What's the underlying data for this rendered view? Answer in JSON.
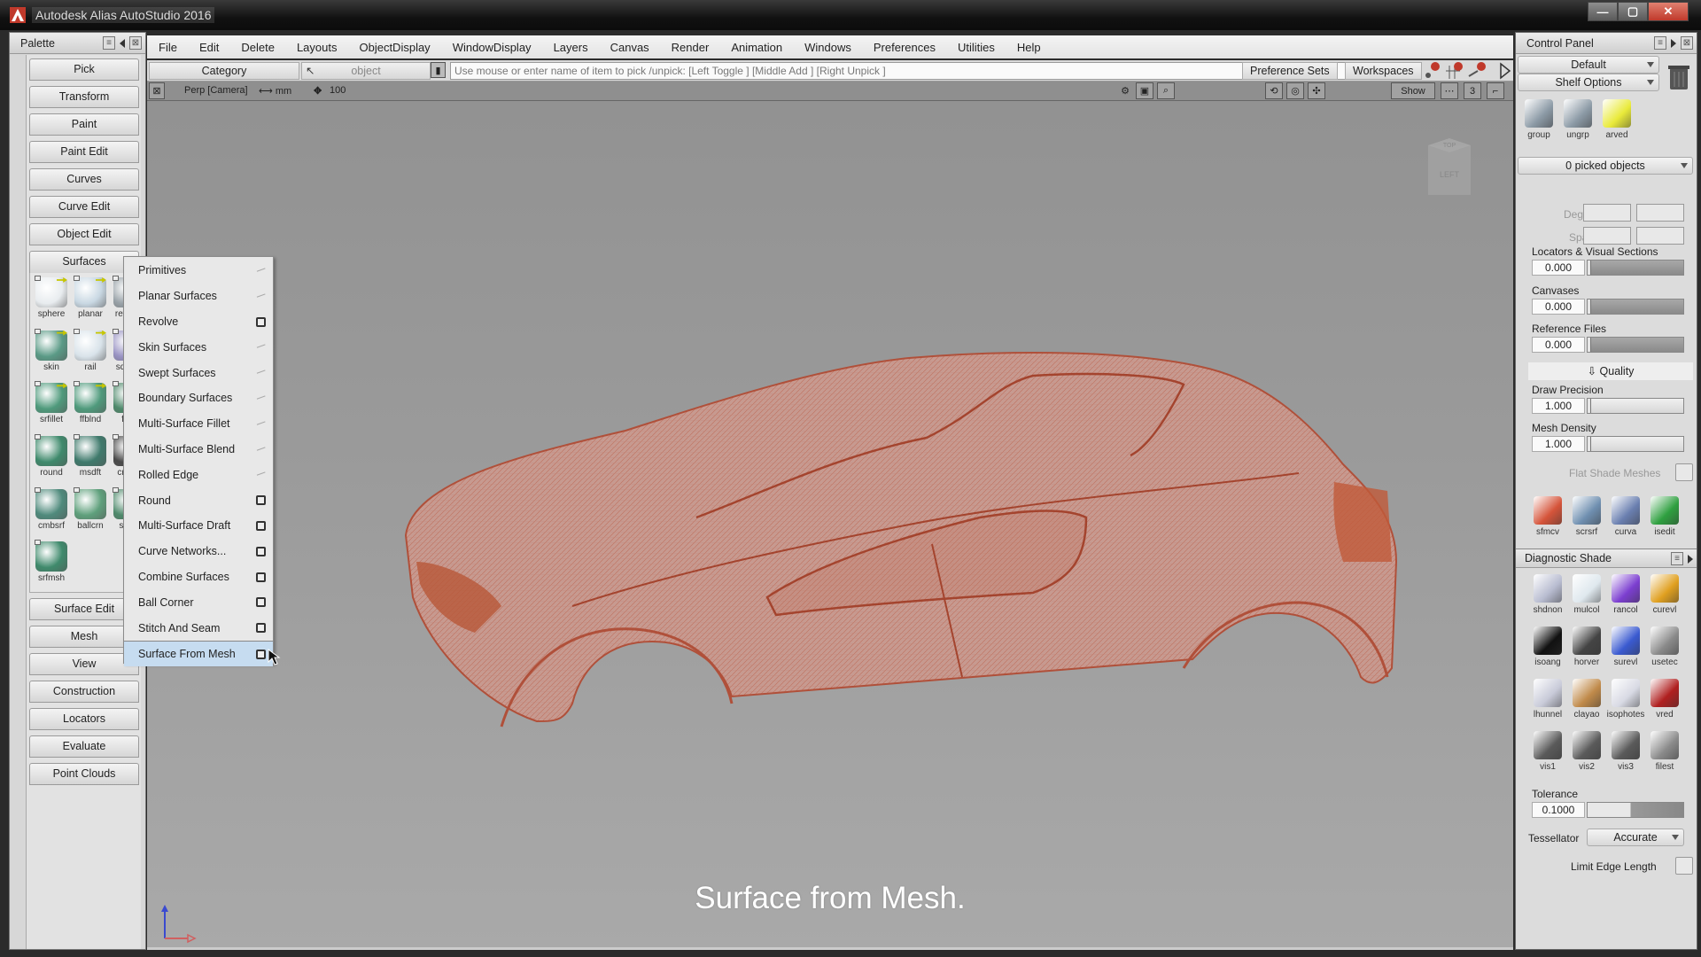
{
  "window": {
    "title": "Autodesk Alias AutoStudio 2016",
    "controls": {
      "minimize": "—",
      "maximize": "▢",
      "close": "✕"
    }
  },
  "menubar": {
    "items": [
      "File",
      "Edit",
      "Delete",
      "Layouts",
      "ObjectDisplay",
      "WindowDisplay",
      "Layers",
      "Canvas",
      "Render",
      "Animation",
      "Windows",
      "Preferences",
      "Utilities",
      "Help"
    ]
  },
  "toolbar": {
    "category_label": "Category",
    "object_label": "object",
    "prompt_value": "Use mouse or enter name of item to pick /unpick: [Left Toggle ] [Middle Add ] [Right Unpick ]",
    "preference_sets_label": "Preference Sets",
    "workspaces_label": "Workspaces"
  },
  "viewbar": {
    "camera_label": "Perp [Camera]",
    "units_label": "⟷ mm",
    "zoom_value": "100",
    "show_label": "Show",
    "layout_number": "3"
  },
  "palette": {
    "title": "Palette",
    "top_buttons": [
      "Pick",
      "Transform",
      "Paint",
      "Paint Edit",
      "Curves",
      "Curve Edit",
      "Object Edit"
    ],
    "surfaces_label": "Surfaces",
    "surface_tools": [
      {
        "label": "sphere",
        "color": "#e8ecef",
        "has_arrow": true
      },
      {
        "label": "planar",
        "color": "#c9d8e3",
        "has_arrow": true
      },
      {
        "label": "revolve",
        "color": "#9aa3a9",
        "has_arrow": false
      },
      {
        "label": "skin",
        "color": "#5a9a86",
        "has_arrow": true
      },
      {
        "label": "rail",
        "color": "#d9e3ea",
        "has_arrow": true
      },
      {
        "label": "square",
        "color": "#9a94c4",
        "has_arrow": false
      },
      {
        "label": "srfillet",
        "color": "#4f9a7c",
        "has_arrow": true
      },
      {
        "label": "ffblnd",
        "color": "#4f9a7c",
        "has_arrow": true
      },
      {
        "label": "fillet",
        "color": "#4f8a6c",
        "has_arrow": false
      },
      {
        "label": "round",
        "color": "#3f8a6c",
        "has_arrow": false
      },
      {
        "label": "msdft",
        "color": "#3f7a6c",
        "has_arrow": false
      },
      {
        "label": "crvnet",
        "color": "#4a4a4a",
        "has_arrow": false
      },
      {
        "label": "cmbsrf",
        "color": "#4f8a7c",
        "has_arrow": false
      },
      {
        "label": "ballcrn",
        "color": "#5fa07c",
        "has_arrow": false
      },
      {
        "label": "stitch",
        "color": "#4f8a6c",
        "has_arrow": false
      },
      {
        "label": "srfmsh",
        "color": "#3f8a6c",
        "has_arrow": false
      }
    ],
    "bottom_buttons": [
      "Surface Edit",
      "Mesh",
      "View",
      "Construction",
      "Locators",
      "Evaluate",
      "Point Clouds"
    ]
  },
  "surfaces_menu": {
    "items": [
      {
        "label": "Primitives",
        "marker": "submenu"
      },
      {
        "label": "Planar Surfaces",
        "marker": "submenu"
      },
      {
        "label": "Revolve",
        "marker": "options"
      },
      {
        "label": "Skin Surfaces",
        "marker": "submenu"
      },
      {
        "label": "Swept Surfaces",
        "marker": "submenu"
      },
      {
        "label": "Boundary Surfaces",
        "marker": "submenu"
      },
      {
        "label": "Multi-Surface Fillet",
        "marker": "submenu"
      },
      {
        "label": "Multi-Surface Blend",
        "marker": "submenu"
      },
      {
        "label": "Rolled Edge",
        "marker": "submenu"
      },
      {
        "label": "Round",
        "marker": "options"
      },
      {
        "label": "Multi-Surface Draft",
        "marker": "options"
      },
      {
        "label": "Curve Networks...",
        "marker": "options"
      },
      {
        "label": "Combine Surfaces",
        "marker": "options"
      },
      {
        "label": "Ball Corner",
        "marker": "options"
      },
      {
        "label": "Stitch And Seam",
        "marker": "options"
      },
      {
        "label": "Surface From Mesh",
        "marker": "options",
        "active": true
      }
    ]
  },
  "viewport": {
    "caption": "Surface from Mesh.",
    "view_cube": {
      "top": "TOP",
      "front": "LEFT"
    },
    "model_color": "#c0543a",
    "background_color": "#9a9a9a"
  },
  "control_panel": {
    "title": "Control Panel",
    "preset_dropdown": "Default",
    "shelf_options_dropdown": "Shelf Options",
    "shelf_tools": [
      {
        "label": "group",
        "color": "#8c9aa6"
      },
      {
        "label": "ungrp",
        "color": "#8c9aa6"
      },
      {
        "label": "arved",
        "color": "#e9ea3a"
      }
    ],
    "picked_objects_dropdown": "0 picked objects",
    "degree_label": "Degree",
    "spans_label": "Spans",
    "locators_label": "Locators & Visual Sections",
    "locators_value": "0.000",
    "canvases_label": "Canvases",
    "canvases_value": "0.000",
    "reference_files_label": "Reference Files",
    "reference_files_value": "0.000",
    "quality_label": "Quality",
    "draw_precision_label": "Draw Precision",
    "draw_precision_value": "1.000",
    "mesh_density_label": "Mesh Density",
    "mesh_density_value": "1.000",
    "flat_shade_label": "Flat Shade Meshes",
    "quality_tools": [
      {
        "label": "sfmcv",
        "color": "#d5543a"
      },
      {
        "label": "scrsrf",
        "color": "#6f8fb0"
      },
      {
        "label": "curva",
        "color": "#6a7fb0"
      },
      {
        "label": "isedit",
        "color": "#2fa040"
      }
    ],
    "diagnostic_title": "Diagnostic Shade",
    "diagnostic_tools": [
      {
        "label": "shdnon",
        "color": "#b8bcd0"
      },
      {
        "label": "mulcol",
        "color": "#dfe8ee"
      },
      {
        "label": "rancol",
        "color": "#7c3fd0"
      },
      {
        "label": "curevl",
        "color": "#e0a020"
      },
      {
        "label": "isoang",
        "color": "#111111"
      },
      {
        "label": "horver",
        "color": "#444444"
      },
      {
        "label": "surevl",
        "color": "#3a5ad0"
      },
      {
        "label": "usetec",
        "color": "#8a8a8a"
      },
      {
        "label": "lhunnel",
        "color": "#c8cad8"
      },
      {
        "label": "clayao",
        "color": "#c08a4a"
      },
      {
        "label": "isophotes",
        "color": "#d8dae4"
      },
      {
        "label": "vred",
        "color": "#b02020"
      },
      {
        "label": "vis1",
        "color": "#5a5a5a"
      },
      {
        "label": "vis2",
        "color": "#5a5a5a"
      },
      {
        "label": "vis3",
        "color": "#5a5a5a"
      },
      {
        "label": "filest",
        "color": "#8a8a8a"
      }
    ],
    "tolerance_label": "Tolerance",
    "tolerance_value": "0.1000",
    "tessellator_label": "Tessellator",
    "tessellator_value": "Accurate",
    "limit_edge_label": "Limit Edge Length"
  }
}
